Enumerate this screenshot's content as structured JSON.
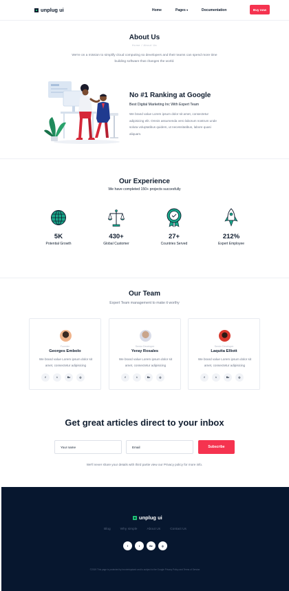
{
  "nav": {
    "brand": "unplug ui",
    "links": [
      "Home",
      "Pages",
      "Documentation"
    ],
    "pages_caret": "▾",
    "cta": "Buy now"
  },
  "about": {
    "title": "About Us",
    "breadcrumb": "Home / About Us",
    "description": "We're on a mission to simplify cloud computing so developers and their teams can spend more time building software that changes the world.",
    "rank_title": "No #1 Ranking at Google",
    "rank_subtitle": "Best Digital Marketing Inc With Expert Team",
    "rank_description": "We brand value Lorem ipsum dolor sit amet, consectetur adipisicing elit. Omnis assumenda vero laborum nostrum unde soluta voluptatibus quidem, ut necessitatibus, labore quasi aliquam."
  },
  "experience": {
    "title": "Our Experience",
    "subtitle": "We have completed 150+ projects succesfully",
    "stats": [
      {
        "value": "5K",
        "label": "Potential Growth",
        "icon": "globe-icon"
      },
      {
        "value": "430+",
        "label": "Global Customer",
        "icon": "balance-scale-icon"
      },
      {
        "value": "27+",
        "label": "Countries Served",
        "icon": "award-badge-icon"
      },
      {
        "value": "212%",
        "label": "Expert Employee",
        "icon": "rocket-icon"
      }
    ]
  },
  "team": {
    "title": "Our Team",
    "subtitle": "Expert Team management to make it worthy",
    "members": [
      {
        "role": "Founder",
        "name": "Georges Embolo",
        "description": "We brand value Lorem ipsum dolor sit amet, consectetur adipisicing"
      },
      {
        "role": "Senior Developer",
        "name": "Yeray Rosales",
        "description": "We brand value Lorem ipsum dolor sit amet, consectetur adipisicing"
      },
      {
        "role": "Senior Developer",
        "name": "Laquita Elliott",
        "description": "We brand value Lorem ipsum dolor sit amet, consectetur adipisicing"
      }
    ],
    "socials": [
      "f",
      "t",
      "Be",
      "◎"
    ]
  },
  "newsletter": {
    "title": "Get great articles direct to your inbox",
    "name_placeholder": "Your name",
    "email_placeholder": "Email",
    "button": "Subscribe",
    "note": "We'll never share your details with third partie view our Privacy policy for more info."
  },
  "footer": {
    "brand": "unplug ui",
    "links": [
      "Blog",
      "Why simple",
      "About Us",
      "Contact Us"
    ],
    "socials": [
      "f",
      "t",
      "Be",
      "◎"
    ],
    "copyright": "©2019 This page is protected by brovimtopdash and is subject to the Google Privacy Policy and Terms of Service."
  },
  "colors": {
    "accent": "#f5334f",
    "brand_green": "#1dbf73",
    "footer_bg": "#07172f",
    "icon_teal": "#18a789"
  }
}
